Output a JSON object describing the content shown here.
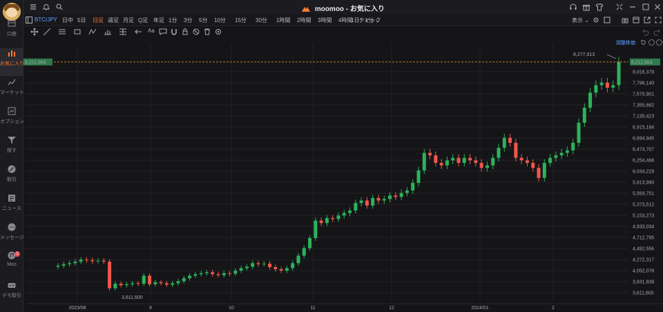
{
  "window": {
    "app_name": "moomoo",
    "separator": "-",
    "view_name": "お気に入り"
  },
  "sidebar": {
    "items": [
      {
        "label": "口座",
        "icon": "account-icon"
      },
      {
        "label": "お気に入り",
        "icon": "bar-chart-icon",
        "active": true
      },
      {
        "label": "マーケット",
        "icon": "market-icon"
      },
      {
        "label": "オプション",
        "icon": "options-icon"
      },
      {
        "label": "探す",
        "icon": "funnel-icon"
      },
      {
        "label": "取引",
        "icon": "trade-icon"
      },
      {
        "label": "ニュース",
        "icon": "news-icon"
      },
      {
        "label": "メッセージ",
        "icon": "message-icon"
      },
      {
        "label": "Moo",
        "icon": "moo-icon",
        "badge": "1"
      },
      {
        "label": "デモ取引",
        "icon": "demo-trade-icon"
      }
    ]
  },
  "toolbar": {
    "symbol": "BTC/JPY",
    "timeframes": [
      "日中",
      "5日",
      "日足",
      "週足",
      "月足",
      "Q足",
      "年足",
      "1分",
      "3分",
      "5分",
      "10分",
      "15分",
      "30分",
      "1時間",
      "2時間",
      "3時間",
      "4時間",
      "ティック"
    ],
    "active_timeframe": "日足",
    "interval_select": "1日：1分 ⌄",
    "display_label": "表示 ⌄",
    "draw_text_tool": "Aa"
  },
  "chart": {
    "adjust_label": "調整株価",
    "current_price_label": "8,211,864",
    "high_annotation": "8,277,913",
    "low_annotation": "3,611,600",
    "y_ticks": [
      "8,016,379",
      "7,796,140",
      "7,575,901",
      "7,355,662",
      "7,135,423",
      "6,915,184",
      "6,694,945",
      "6,474,707",
      "6,254,468",
      "6,034,229",
      "5,813,990",
      "5,593,751",
      "5,373,512",
      "5,153,273",
      "4,933,034",
      "4,712,795",
      "4,492,556",
      "4,272,317",
      "4,052,078",
      "3,831,839",
      "3,611,600"
    ],
    "x_ticks": [
      "2023/08",
      "9",
      "10",
      "11",
      "12",
      "2024/01",
      "2"
    ],
    "colors": {
      "up": "#2bb35a",
      "down": "#f0574a",
      "price_line": "#c87a2a",
      "price_box": "#2f7a4a"
    }
  },
  "chart_data": {
    "type": "candlestick",
    "title": "BTC/JPY",
    "ylim": [
      3611600,
      8277913
    ],
    "last": 8211864,
    "high": 8277913,
    "low": 3611600,
    "close_series": [
      4150000,
      4180000,
      4200000,
      4230000,
      4270000,
      4260000,
      4240000,
      4250000,
      4230000,
      3700000,
      3790000,
      3760000,
      3780000,
      3800000,
      3790000,
      3950000,
      3780000,
      3820000,
      3800000,
      3770000,
      3800000,
      3840000,
      3900000,
      3950000,
      3980000,
      4000000,
      4020000,
      3980000,
      3960000,
      4000000,
      3990000,
      4050000,
      4100000,
      4130000,
      4200000,
      4180000,
      4190000,
      4120000,
      4080000,
      4050000,
      4100000,
      4200000,
      4350000,
      4500000,
      4700000,
      5050000,
      5000000,
      5100000,
      5080000,
      5150000,
      5200000,
      5250000,
      5400000,
      5450000,
      5350000,
      5500000,
      5450000,
      5480000,
      5550000,
      5520000,
      5600000,
      5650000,
      5800000,
      6050000,
      6400000,
      6350000,
      6200000,
      6150000,
      6250000,
      6300000,
      6200000,
      6300000,
      6250000,
      6200000,
      6100000,
      6150000,
      6300000,
      6500000,
      6700000,
      6600000,
      6300000,
      6250000,
      6200000,
      6100000,
      5900000,
      6200000,
      6300000,
      6350000,
      6400000,
      6450000,
      6600000,
      7000000,
      7300000,
      7600000,
      7750000,
      7800000,
      7700000,
      7750000,
      8211864
    ],
    "xlabel": "",
    "ylabel": ""
  }
}
